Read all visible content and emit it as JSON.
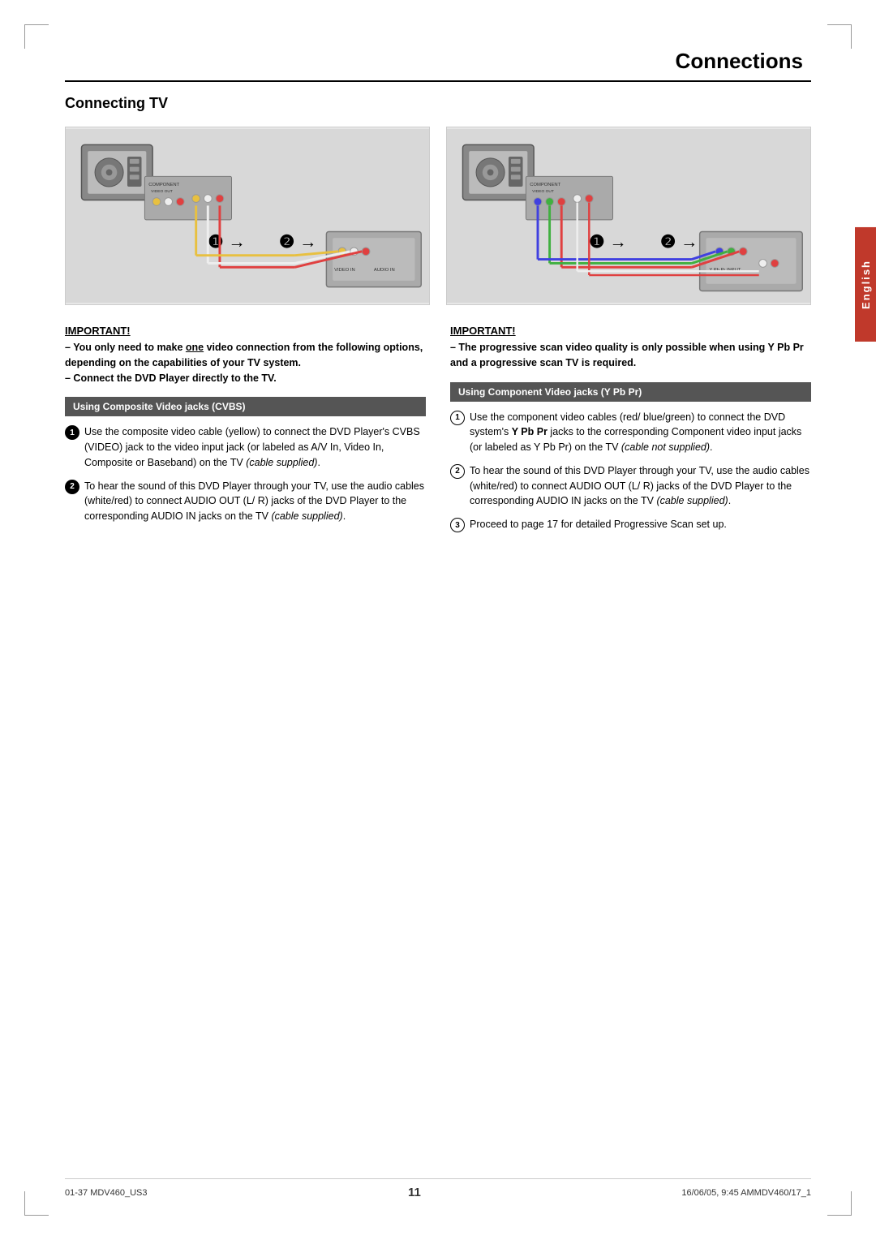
{
  "page": {
    "title": "Connections",
    "section_heading": "Connecting TV",
    "english_tab": "English",
    "page_number": "11",
    "footer_left": "01-37 MDV460_US3",
    "footer_center": "11",
    "footer_right": "16/06/05, 9:45 AMMDV460/17_1"
  },
  "left_column": {
    "important_label": "IMPORTANT!",
    "important_lines": [
      "– You only need to make one video connection from the following options, depending on the capabilities of your TV system.",
      "– Connect the DVD Player directly to the TV."
    ],
    "sub_section_header": "Using Composite Video jacks (CVBS)",
    "list_items": [
      {
        "num": "1",
        "style": "filled",
        "text": "Use the composite video cable (yellow) to connect the DVD Player's CVBS (VIDEO) jack to the video input jack (or labeled as A/V In, Video In, Composite or Baseband) on the TV (cable supplied)."
      },
      {
        "num": "2",
        "style": "filled",
        "text": "To hear the sound of this DVD Player through your TV, use the audio cables (white/red) to connect AUDIO OUT (L/ R) jacks of the DVD Player to the corresponding AUDIO IN jacks on the TV (cable supplied)."
      }
    ]
  },
  "right_column": {
    "important_label": "IMPORTANT!",
    "important_lines": [
      "– The progressive scan video quality is only possible when using Y Pb Pr and a progressive scan TV is required."
    ],
    "sub_section_header": "Using Component Video jacks (Y Pb Pr)",
    "list_items": [
      {
        "num": "1",
        "style": "outline",
        "text": "Use the component video cables (red/blue/green) to connect the DVD system's Y Pb Pr jacks to the corresponding Component video input jacks (or labeled as Y Pb Pr) on the TV (cable not supplied)."
      },
      {
        "num": "2",
        "style": "outline",
        "text": "To hear the sound of this DVD Player through your TV, use the audio cables (white/red) to connect AUDIO OUT (L/ R) jacks of the DVD Player to the corresponding AUDIO IN jacks on the TV (cable supplied)."
      },
      {
        "num": "3",
        "style": "outline",
        "text": "Proceed to page 17 for detailed Progressive Scan set up."
      }
    ]
  }
}
